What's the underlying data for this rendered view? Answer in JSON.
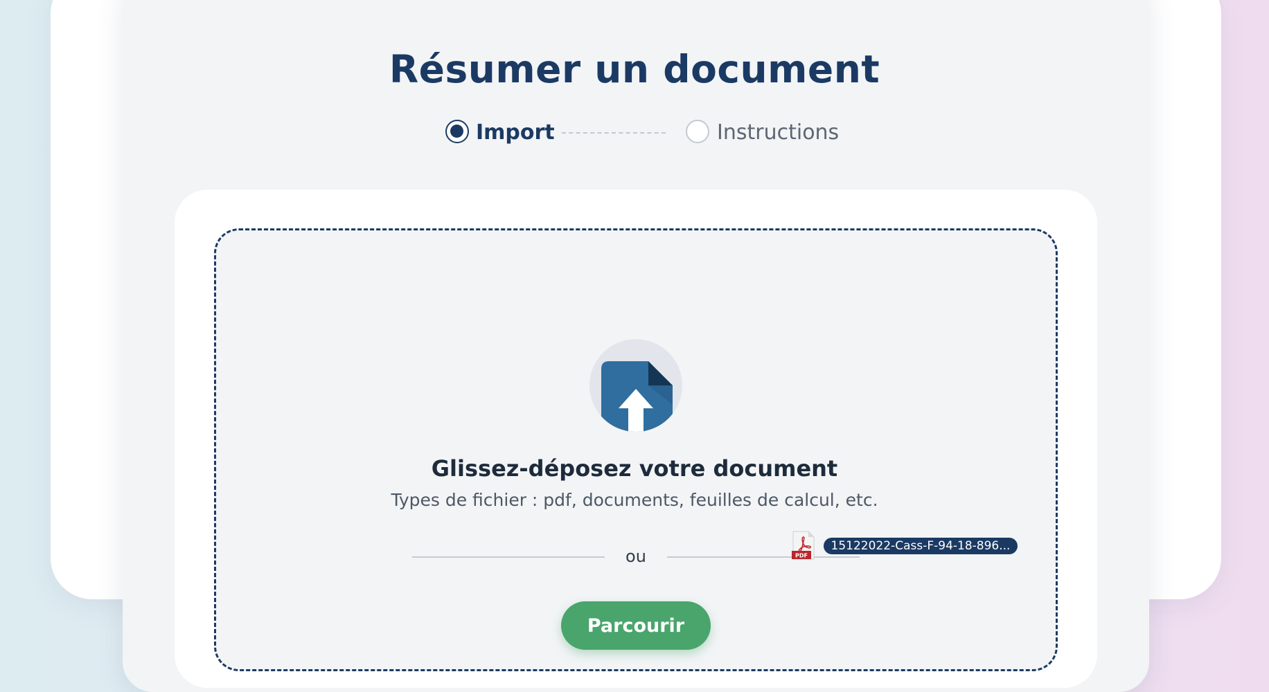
{
  "page": {
    "title": "Résumer un document"
  },
  "stepper": {
    "steps": [
      {
        "label": "Import",
        "state": "active"
      },
      {
        "label": "Instructions",
        "state": "inactive"
      }
    ]
  },
  "dropzone": {
    "icon": "file-upload-icon",
    "title": "Glissez-déposez votre document",
    "subtitle": "Types de fichier : pdf, documents, feuilles de calcul, etc.",
    "or_text": "ou",
    "browse_label": "Parcourir"
  },
  "dragged_file": {
    "icon": "pdf-file-icon",
    "icon_text": "PDF",
    "name": "15122022-Cass-F-94-18-896..."
  },
  "colors": {
    "primary": "#1b3a63",
    "accent": "#49a56b",
    "pdf": "#b8272c",
    "upload_icon": "#2f6e9e"
  }
}
